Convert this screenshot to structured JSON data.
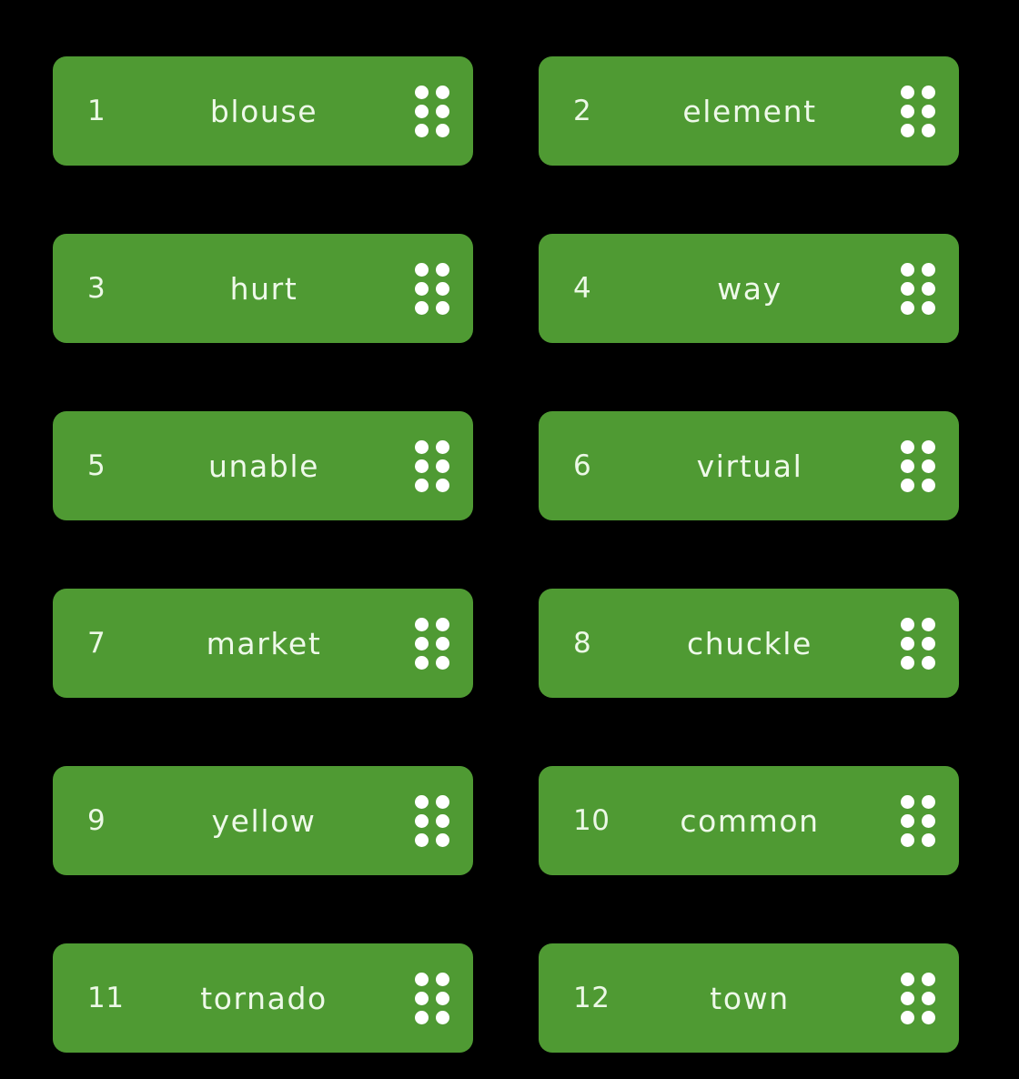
{
  "board": {
    "background_color": "#000000",
    "card_color": "#4f9a33",
    "text_color": "#eef9e9",
    "columns": 2,
    "rows": 6,
    "total_cards": 12
  },
  "cards": [
    {
      "index": "1",
      "word": "blouse",
      "handle_icon": "drag-handle-dots-icon"
    },
    {
      "index": "2",
      "word": "element",
      "handle_icon": "drag-handle-dots-icon"
    },
    {
      "index": "3",
      "word": "hurt",
      "handle_icon": "drag-handle-dots-icon"
    },
    {
      "index": "4",
      "word": "way",
      "handle_icon": "drag-handle-dots-icon"
    },
    {
      "index": "5",
      "word": "unable",
      "handle_icon": "drag-handle-dots-icon"
    },
    {
      "index": "6",
      "word": "virtual",
      "handle_icon": "drag-handle-dots-icon"
    },
    {
      "index": "7",
      "word": "market",
      "handle_icon": "drag-handle-dots-icon"
    },
    {
      "index": "8",
      "word": "chuckle",
      "handle_icon": "drag-handle-dots-icon"
    },
    {
      "index": "9",
      "word": "yellow",
      "handle_icon": "drag-handle-dots-icon"
    },
    {
      "index": "10",
      "word": "common",
      "handle_icon": "drag-handle-dots-icon"
    },
    {
      "index": "11",
      "word": "tornado",
      "handle_icon": "drag-handle-dots-icon"
    },
    {
      "index": "12",
      "word": "town",
      "handle_icon": "drag-handle-dots-icon"
    }
  ]
}
